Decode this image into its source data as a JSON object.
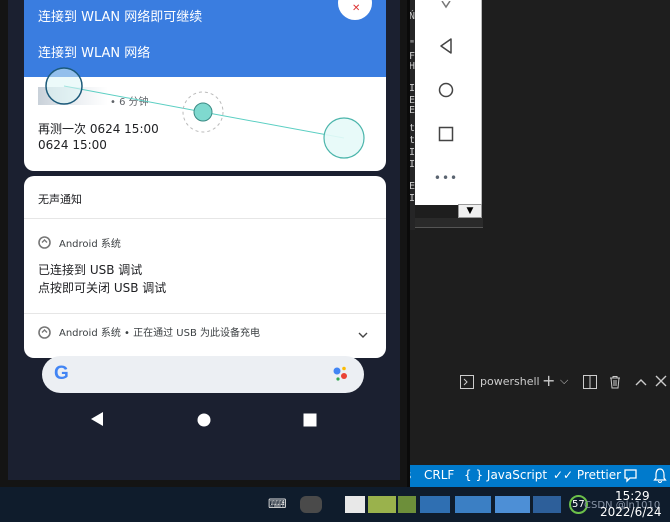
{
  "phone": {
    "wlan_notice": "连接到 WLAN 网络即可继续",
    "wlan_link": "连接到 WLAN 网络",
    "recent": {
      "app_time": "• 6 分钟",
      "line1": "再测一次 0624 15:00",
      "line2": "0624 15:00"
    },
    "silent_header": "无声通知",
    "usb_notification": {
      "app": "Android 系统",
      "title": "已连接到 USB 调试",
      "body": "点按即可关闭 USB 调试"
    },
    "charging_notification": "Android 系统 • 正在通过 USB 为此设备充电",
    "expand_icon": "chevron-down-icon"
  },
  "emulator_panel": {
    "buttons": [
      "back-icon",
      "home-icon",
      "overview-icon",
      "more-icon"
    ],
    "more_label": "•••",
    "scroll_glyph": "▼"
  },
  "editor_chars": [
    "Ń",
    "\"",
    "F",
    "H",
    "I",
    "E",
    "E",
    "t",
    "t",
    "I",
    "I",
    "E",
    "I"
  ],
  "terminal": {
    "shell_label": "powershell",
    "add_label": "+",
    "dropdown_label": "⌵"
  },
  "status_bar": {
    "eol": "CRLF",
    "language": "{ } JavaScript",
    "prettier": "✓✓ Prettier"
  },
  "taskbar": {
    "badge_number": "57",
    "watermark": "CSDN @ln1010",
    "time": "15:29",
    "date": "2022/6/24"
  },
  "colors": {
    "header_blue": "#3a7de0",
    "status_blue": "#007acc",
    "touch_dot": "#7fd9cf"
  }
}
